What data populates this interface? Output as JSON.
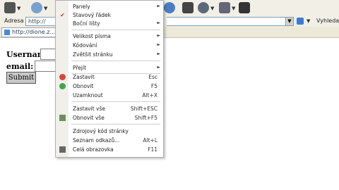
{
  "address_bar": {
    "label": "Adresa",
    "value": "http://",
    "search_label": "Vyhleda"
  },
  "tab": {
    "title": "http://dione.z..."
  },
  "form": {
    "username_label": "Username:",
    "email_label": "email:",
    "submit_label": "Submit"
  },
  "menu": {
    "items": [
      {
        "label": "Panely",
        "arrow": true
      },
      {
        "label": "Stavový řádek",
        "checked": true
      },
      {
        "label": "Boční lišty",
        "arrow": true
      },
      {
        "label": "Velikost písma",
        "arrow": true
      },
      {
        "label": "Kódování",
        "arrow": true
      },
      {
        "label": "Zvětšit stránku",
        "arrow": true
      },
      {
        "label": "Přejít",
        "arrow": true
      },
      {
        "label": "Zastavit",
        "shortcut": "Esc",
        "icon": "stop-icon"
      },
      {
        "label": "Obnovit",
        "shortcut": "F5",
        "icon": "refresh-icon"
      },
      {
        "label": "Uzamknout",
        "shortcut": "Alt+X"
      },
      {
        "label": "Zastavit vše",
        "shortcut": "Shift+ESC"
      },
      {
        "label": "Obnovit vše",
        "shortcut": "Shift+F5",
        "icon": "refresh-all-icon"
      },
      {
        "label": "Zdrojový kód stránky"
      },
      {
        "label": "Seznam odkazů...",
        "shortcut": "Alt+L"
      },
      {
        "label": "Celá obrazovka",
        "shortcut": "F11",
        "icon": "fullscreen-icon"
      }
    ]
  },
  "colors": {
    "toolbar_bg": "#f1efe6",
    "menu_bg": "#ffffff",
    "check": "#c0392b"
  }
}
